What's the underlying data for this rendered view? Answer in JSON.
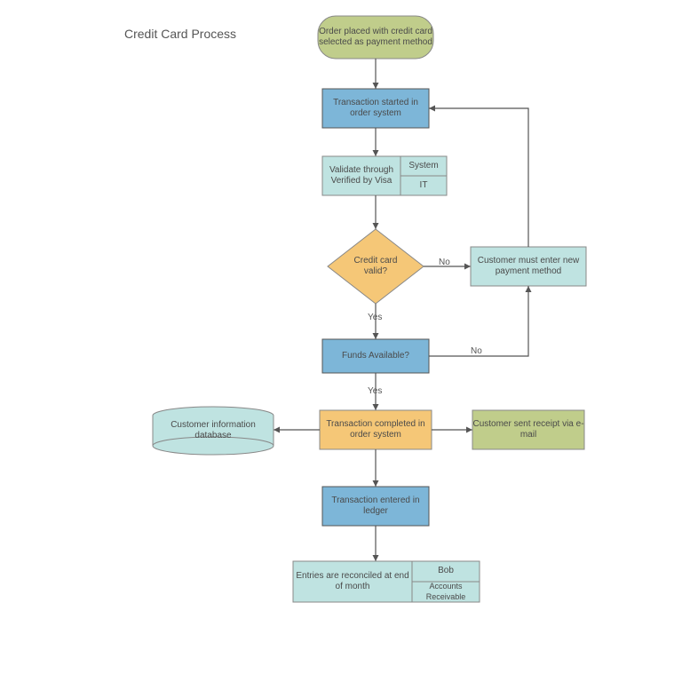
{
  "title": "Credit Card Process",
  "nodes": {
    "start": "Order placed with credit card selected as payment method",
    "txn_started": "Transaction started in order system",
    "validate": {
      "main": "Validate through Verified by Visa",
      "a": "System",
      "b": "IT"
    },
    "valid_q": "Credit card valid?",
    "new_payment": "Customer must enter new payment method",
    "funds_q": "Funds Available?",
    "txn_complete": "Transaction completed in order system",
    "cust_db": "Customer information database",
    "receipt": "Customer sent receipt via e-mail",
    "ledger": "Transaction entered in ledger",
    "reconcile": {
      "main": "Entries are reconciled at end of month",
      "a": "Bob",
      "b": "Accounts Receivable"
    }
  },
  "edges": {
    "yes": "Yes",
    "no": "No"
  },
  "colors": {
    "blue": "#bfe3e1",
    "dblue": "#7db6d8",
    "green": "#c0cd8b",
    "orange": "#f5c777",
    "stroke": "#555"
  }
}
